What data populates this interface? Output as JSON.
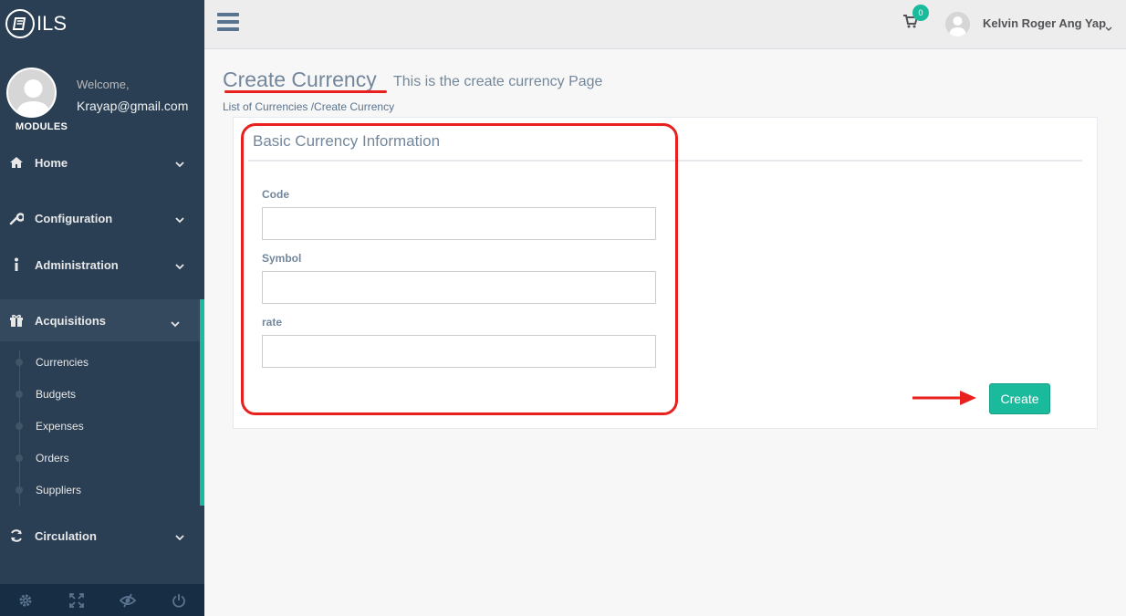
{
  "brand": {
    "name": "ILS"
  },
  "profile": {
    "welcome": "Welcome,",
    "email": "Krayap@gmail.com"
  },
  "sidebar": {
    "section_title": "MODULES",
    "items": [
      {
        "label": "Home",
        "icon": "home-icon"
      },
      {
        "label": "Configuration",
        "icon": "wrench-icon"
      },
      {
        "label": "Administration",
        "icon": "info-icon"
      },
      {
        "label": "Acquisitions",
        "icon": "gift-icon",
        "active": true
      },
      {
        "label": "Circulation",
        "icon": "refresh-icon"
      }
    ],
    "children": [
      {
        "label": "Currencies"
      },
      {
        "label": "Budgets"
      },
      {
        "label": "Expenses"
      },
      {
        "label": "Orders"
      },
      {
        "label": "Suppliers"
      }
    ],
    "footer_icons": [
      "settings-icon",
      "fullscreen-icon",
      "eye-slash-icon",
      "power-icon"
    ]
  },
  "topnav": {
    "cart_count": "0",
    "user_name": "Kelvin Roger Ang Yap"
  },
  "page": {
    "title": "Create Currency",
    "subtitle": "This is the create currency Page",
    "breadcrumb": "List of Currencies /Create Currency"
  },
  "form": {
    "section_title": "Basic Currency Information",
    "fields": [
      {
        "label": "Code",
        "value": ""
      },
      {
        "label": "Symbol",
        "value": ""
      },
      {
        "label": "rate",
        "value": ""
      }
    ],
    "submit_label": "Create"
  },
  "colors": {
    "sidebar": "#2A3F54",
    "accent": "#1ABB9C",
    "annotation": "#E8211E"
  }
}
